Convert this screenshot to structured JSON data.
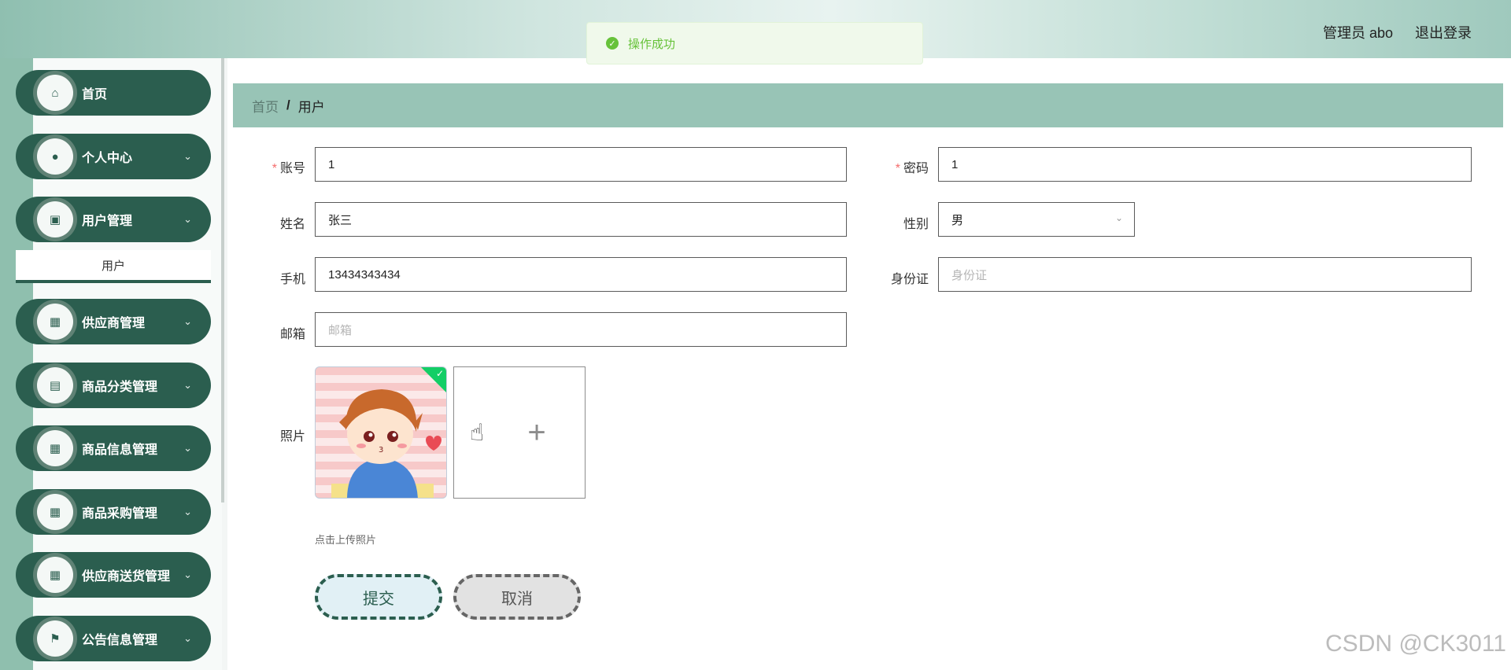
{
  "header": {
    "title": "",
    "user_label": "管理员 abo",
    "logout_label": "退出登录"
  },
  "toast": {
    "message": "操作成功",
    "icon": "check-circle-icon"
  },
  "sidebar": {
    "items": [
      {
        "label": "首页",
        "icon": "home-icon",
        "glyph": "⌂",
        "chevron": ""
      },
      {
        "label": "个人中心",
        "icon": "user-icon",
        "glyph": "●",
        "chevron": "⌄"
      },
      {
        "label": "用户管理",
        "icon": "chart-icon",
        "glyph": "▣",
        "chevron": "⌄"
      },
      {
        "label": "供应商管理",
        "icon": "grid-icon",
        "glyph": "▦",
        "chevron": "⌄"
      },
      {
        "label": "商品分类管理",
        "icon": "clipboard-icon",
        "glyph": "▤",
        "chevron": "⌄"
      },
      {
        "label": "商品信息管理",
        "icon": "grid-icon",
        "glyph": "▦",
        "chevron": "⌄"
      },
      {
        "label": "商品采购管理",
        "icon": "grid-icon",
        "glyph": "▦",
        "chevron": "⌄"
      },
      {
        "label": "供应商送货管理",
        "icon": "grid-icon",
        "glyph": "▦",
        "chevron": "⌄"
      },
      {
        "label": "公告信息管理",
        "icon": "flag-icon",
        "glyph": "⚑",
        "chevron": "⌄"
      }
    ],
    "submenu": {
      "label": "用户"
    }
  },
  "breadcrumb": {
    "home": "首页",
    "separator": "/",
    "current": "用户"
  },
  "form": {
    "account": {
      "label": "账号",
      "required": "*",
      "value": "1"
    },
    "password": {
      "label": "密码",
      "required": "*",
      "value": "1"
    },
    "name": {
      "label": "姓名",
      "value": "张三"
    },
    "gender": {
      "label": "性别",
      "value": "男"
    },
    "phone": {
      "label": "手机",
      "value": "13434343434"
    },
    "idcard": {
      "label": "身份证",
      "placeholder": "身份证"
    },
    "email": {
      "label": "邮箱",
      "placeholder": "邮箱"
    },
    "photo": {
      "label": "照片",
      "tip": "点击上传照片"
    },
    "submit_label": "提交",
    "cancel_label": "取消"
  },
  "watermark": "CSDN @CK3011"
}
